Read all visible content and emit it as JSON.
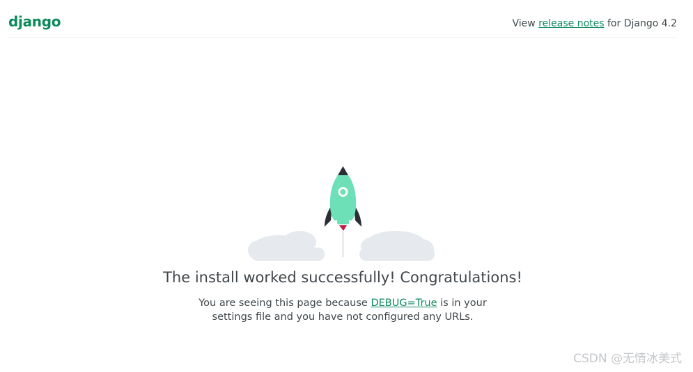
{
  "header": {
    "logo_text": "django",
    "release_prefix": "View ",
    "release_link_text": "release notes",
    "release_suffix": " for Django 4.2"
  },
  "main": {
    "headline": "The install worked successfully! Congratulations!",
    "sub_prefix": "You are seeing this page because ",
    "sub_link": "DEBUG=True",
    "sub_suffix": " is in your",
    "sub_line2": "settings file and you have not configured any URLs."
  },
  "watermark": "CSDN @无情冰美式",
  "icons": {
    "hero": "rocket-launch-icon"
  },
  "colors": {
    "brand_green": "#0c8a5b",
    "rocket_body": "#6ee0b8",
    "rocket_fins": "#2b2e32",
    "flame": "#c41a45",
    "cloud": "#e6e9ed",
    "text": "#41474c"
  }
}
